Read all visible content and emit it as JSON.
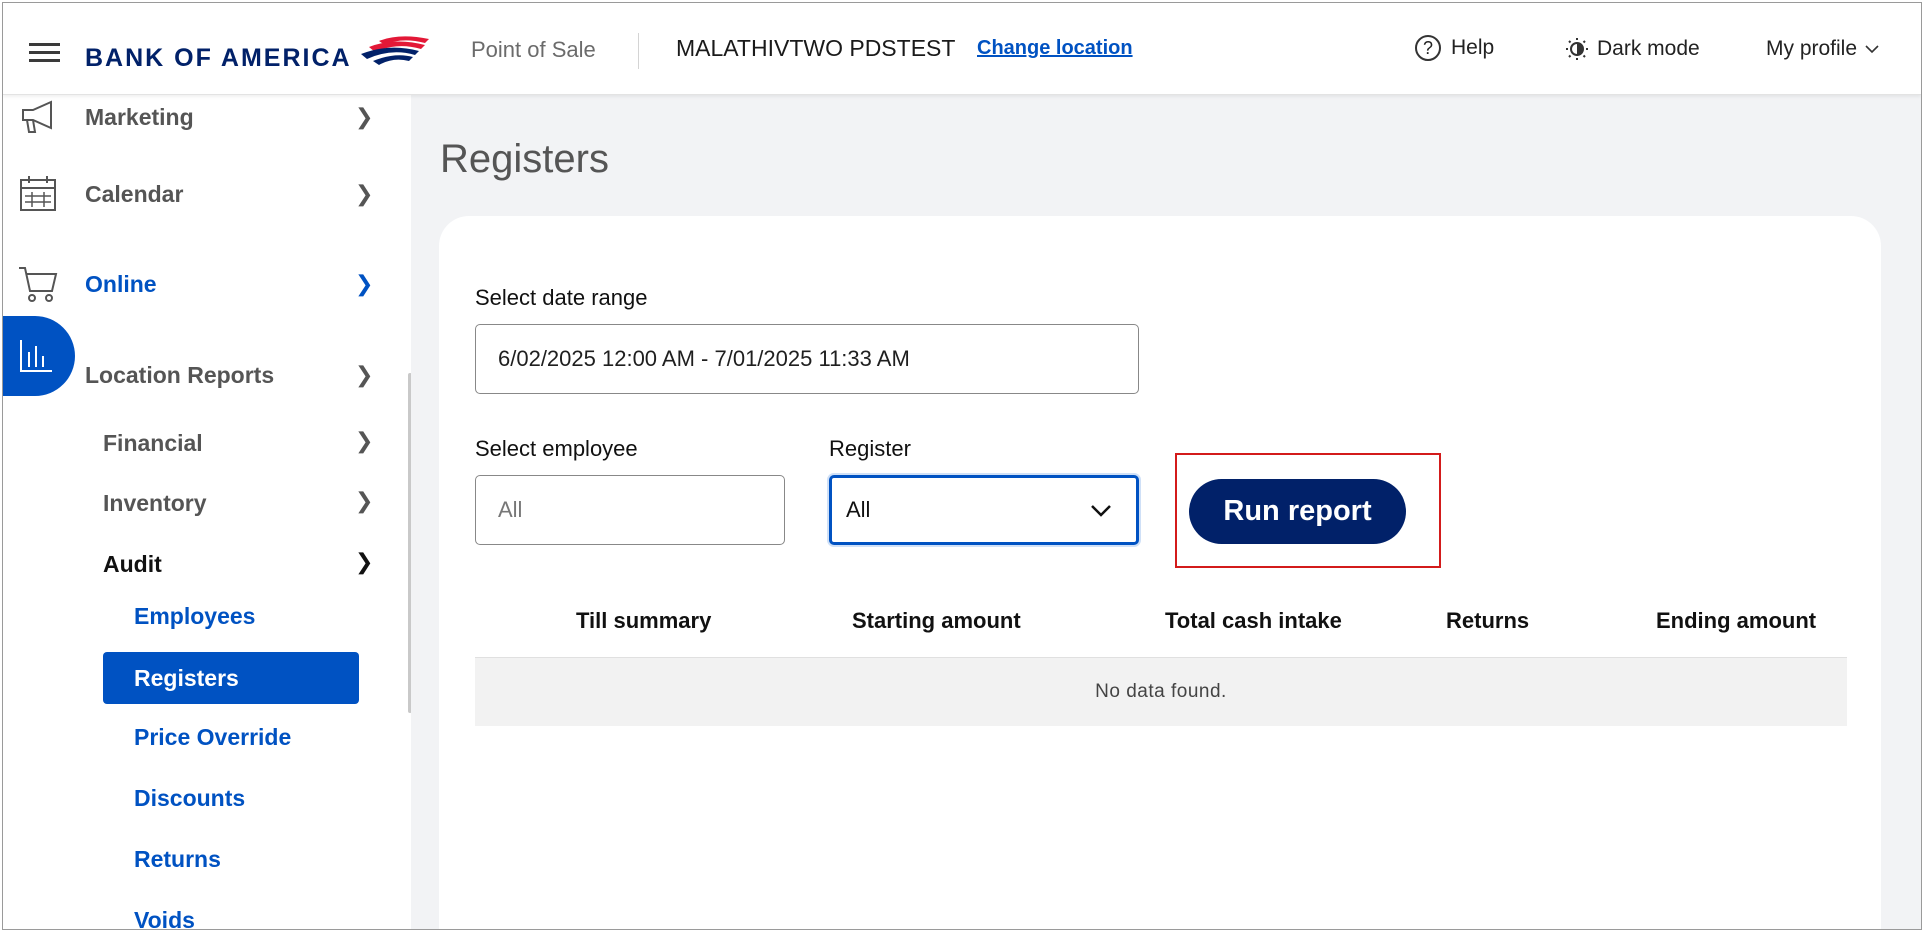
{
  "header": {
    "menu_label": "Menu",
    "brand": "BANK OF AMERICA",
    "app_name": "Point of Sale",
    "location_name": "MALATHIVTWO PDSTEST",
    "change_location": "Change location",
    "help": "Help",
    "dark_mode": "Dark mode",
    "my_profile": "My profile",
    "brand_colors": {
      "navy": "#012169",
      "red": "#e31837"
    }
  },
  "sidebar": {
    "items": [
      {
        "label": "Marketing",
        "icon": "megaphone-icon"
      },
      {
        "label": "Calendar",
        "icon": "calendar-icon"
      },
      {
        "label": "Online",
        "icon": "cart-icon"
      },
      {
        "label": "Location Reports",
        "icon": "bar-chart-icon"
      }
    ],
    "reports_children": [
      {
        "label": "Financial"
      },
      {
        "label": "Inventory"
      },
      {
        "label": "Audit"
      }
    ],
    "audit_children": [
      {
        "label": "Employees"
      },
      {
        "label": "Registers"
      },
      {
        "label": "Price Override"
      },
      {
        "label": "Discounts"
      },
      {
        "label": "Returns"
      },
      {
        "label": "Voids"
      }
    ]
  },
  "main": {
    "title": "Registers",
    "date_range": {
      "label": "Select date range",
      "value": "6/02/2025 12:00 AM - 7/01/2025 11:33 AM"
    },
    "employee": {
      "label": "Select employee",
      "placeholder": "All"
    },
    "register": {
      "label": "Register",
      "value": "All"
    },
    "run_report": "Run report",
    "table": {
      "columns": [
        "Till summary",
        "Starting amount",
        "Total cash intake",
        "Returns",
        "Ending amount"
      ],
      "empty_message": "No data found."
    }
  },
  "colors": {
    "accent": "#0052c2",
    "primary_button": "#012169",
    "highlight": "#d31b1b"
  }
}
